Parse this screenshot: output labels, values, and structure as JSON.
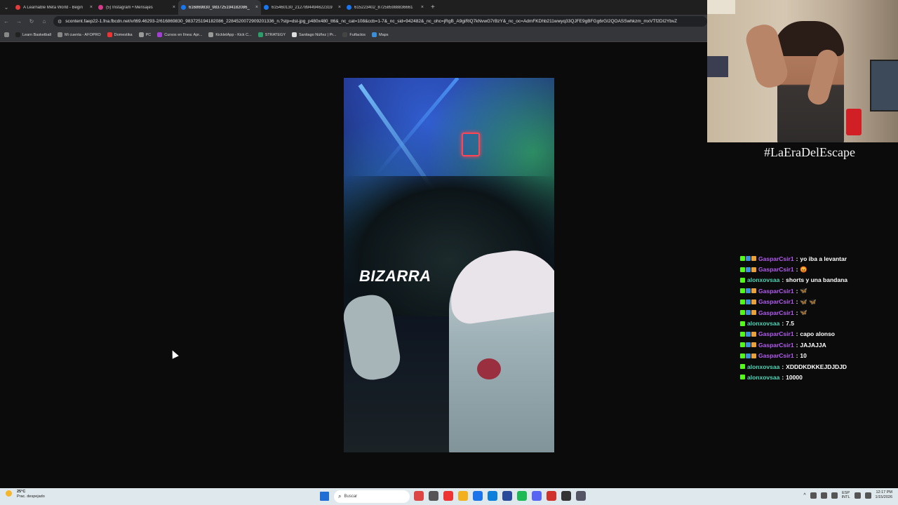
{
  "browser": {
    "tabs": [
      {
        "title": "A Learnable Meta World - Begin",
        "color": "#e23c3c",
        "active": false
      },
      {
        "title": "(5) Instagram • Mensajes",
        "color": "#d63b8a",
        "active": false
      },
      {
        "title": "616869830_983725194182086_",
        "color": "#1877f2",
        "active": true
      },
      {
        "title": "615460130_2127894494622319",
        "color": "#1877f2",
        "active": false
      },
      {
        "title": "615223402_872585988836661",
        "color": "#1877f2",
        "active": false
      }
    ],
    "close_glyph": "×",
    "new_tab_glyph": "+",
    "url": "scontent.faep22-1.fna.fbcdn.net/v/t69.46293-2/616869830_983725194182086_2284520072909201336_n.?stp=dst-jpg_p480x480_tt6&_nc_cat=108&ccb=1-7&_nc_sid=942482&_nc_ohc=jRgB_A9giRlQ7kNvwG7rBzY&_nc_oc=AdmFKDhb211wwyq33QJFE9gBFGg6rGI2QOASSwhkzm_mxVTf2DI2YbvZ",
    "bookmarks": [
      {
        "label": "Learn Basketball",
        "color": "#222"
      },
      {
        "label": "Mi cuenta - AFOPRO",
        "color": "#888"
      },
      {
        "label": "Domestika",
        "color": "#e33"
      },
      {
        "label": "PC",
        "color": "#999"
      },
      {
        "label": "Cursos en línea: Apr...",
        "color": "#a33ed6"
      },
      {
        "label": "KickletApp - Kick C...",
        "color": "#999"
      },
      {
        "label": "STRATEGY",
        "color": "#2c9e6a"
      },
      {
        "label": "Santiago Núñez | Pr...",
        "color": "#ddd"
      },
      {
        "label": "Futfactos",
        "color": "#444"
      },
      {
        "label": "Maps",
        "color": "#3b8ed8"
      }
    ]
  },
  "video": {
    "overlay_text": "BIZARRA"
  },
  "stream": {
    "hashtag": "#LaEraDelEscape",
    "chat": [
      {
        "user": "GasparCsir1",
        "color": "#b25cf0",
        "badges": [
          "k",
          "s",
          "c"
        ],
        "text": "yo iba a levantar"
      },
      {
        "user": "GasparCsir1",
        "color": "#b25cf0",
        "badges": [
          "k",
          "s",
          "c"
        ],
        "text": "😡"
      },
      {
        "user": "alonxovsaa",
        "color": "#4fd4b8",
        "badges": [
          "k"
        ],
        "text": "shorts y una bandana"
      },
      {
        "user": "GasparCsir1",
        "color": "#b25cf0",
        "badges": [
          "k",
          "s",
          "c"
        ],
        "text": "🦋"
      },
      {
        "user": "GasparCsir1",
        "color": "#b25cf0",
        "badges": [
          "k",
          "s",
          "c"
        ],
        "text": "🦋 🦋"
      },
      {
        "user": "GasparCsir1",
        "color": "#b25cf0",
        "badges": [
          "k",
          "s",
          "c"
        ],
        "text": "🦋"
      },
      {
        "user": "alonxovsaa",
        "color": "#4fd4b8",
        "badges": [
          "k"
        ],
        "text": "7.5"
      },
      {
        "user": "GasparCsir1",
        "color": "#b25cf0",
        "badges": [
          "k",
          "s",
          "c"
        ],
        "text": "capo alonso"
      },
      {
        "user": "GasparCsir1",
        "color": "#b25cf0",
        "badges": [
          "k",
          "s",
          "c"
        ],
        "text": "JAJAJJA"
      },
      {
        "user": "GasparCsir1",
        "color": "#b25cf0",
        "badges": [
          "k",
          "s",
          "c"
        ],
        "text": "10"
      },
      {
        "user": "alonxovsaa",
        "color": "#4fd4b8",
        "badges": [
          "k"
        ],
        "text": "XDDDKDKKEJDJDJD"
      },
      {
        "user": "alonxovsaa",
        "color": "#4fd4b8",
        "badges": [
          "k"
        ],
        "text": "10000"
      }
    ]
  },
  "taskbar": {
    "temperature": "25°C",
    "weather": "Prac. despejado",
    "search_placeholder": "Buscar",
    "lang_top": "ESP",
    "lang_bottom": "INTL",
    "time": "12:17 PM",
    "date": "1/15/2026",
    "pinned_colors": [
      "#d44",
      "#555",
      "#e33",
      "#f2b01e",
      "#1a73e8",
      "#0b7dda",
      "#2a4a9a",
      "#1db954",
      "#5865f2",
      "#d0322b",
      "#333",
      "#556"
    ]
  }
}
